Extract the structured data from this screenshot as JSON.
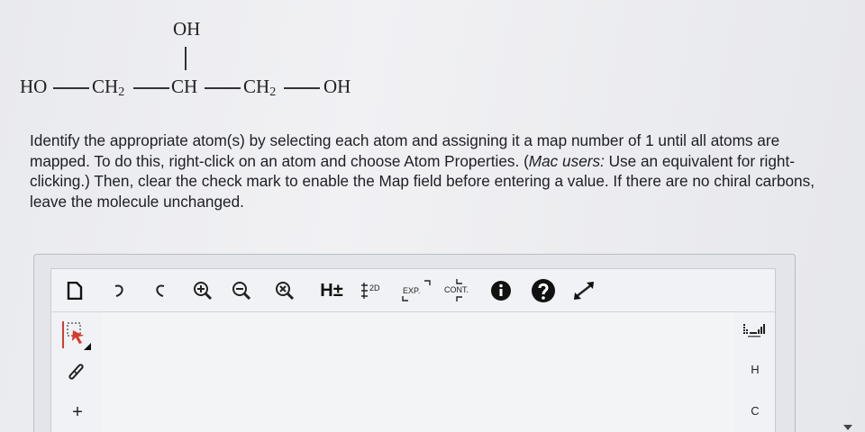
{
  "molecule": {
    "top_group": "OH",
    "chain": [
      "HO",
      "CH",
      "CH",
      "CH",
      "OH"
    ],
    "subscript": "2"
  },
  "instructions": {
    "part1": "Identify the appropriate atom(s) by selecting each atom and assigning it a map number of 1 until all atoms are mapped. To do this, right-click on an atom and choose Atom Properties. (",
    "italic": "Mac users:",
    "part2": " Use an equivalent for right-clicking.) Then, clear the check mark to enable the Map field before entering a value. If there are no chiral carbons, leave the molecule unchanged."
  },
  "toolbar": {
    "h_label": "H±",
    "two_d_label": "2D",
    "exp_label": "EXP.",
    "cont_label": "CONT.",
    "icons": [
      "new-document-icon",
      "undo-icon",
      "redo-icon",
      "zoom-in-icon",
      "zoom-out-icon",
      "zoom-reset-icon",
      "info-icon",
      "help-icon",
      "fullscreen-icon"
    ]
  },
  "side_elements": {
    "h": "H",
    "c": "C",
    "plus": "+"
  },
  "colors": {
    "select_accent": "#d93a2b",
    "info_circle": "#111111"
  }
}
